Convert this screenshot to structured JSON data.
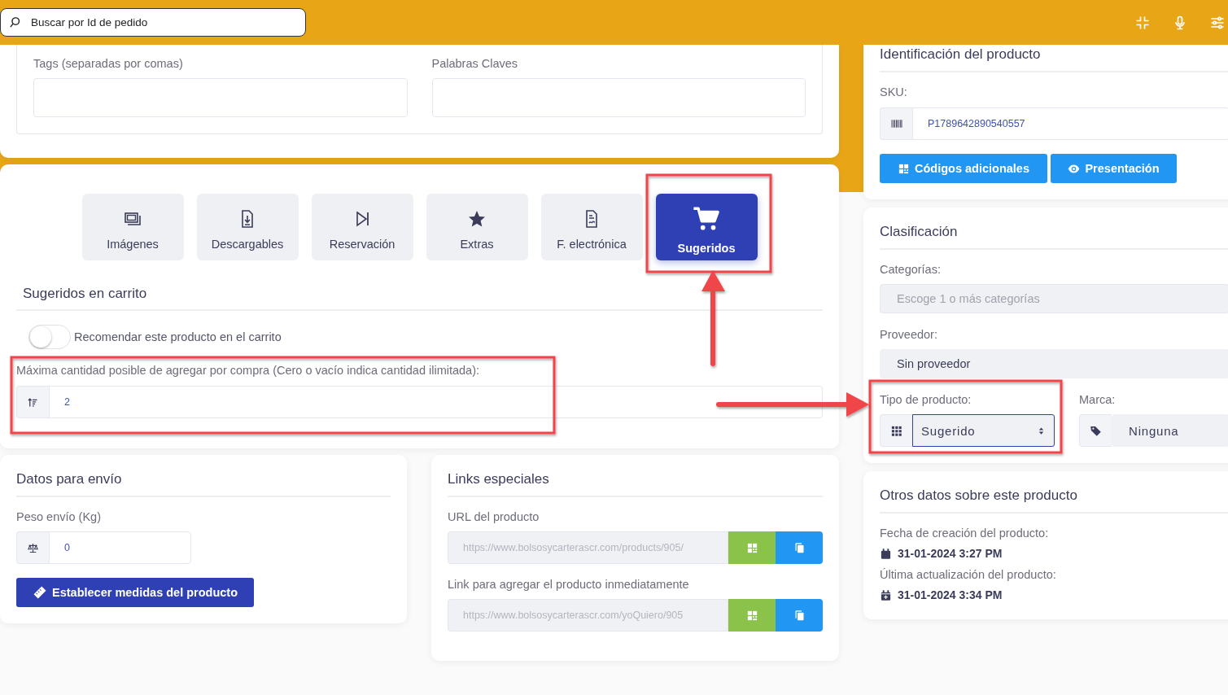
{
  "header": {
    "search": {
      "placeholder": "Buscar por Id de pedido"
    }
  },
  "seo": {
    "fields": [
      {
        "label": "Tags (separadas por comas)"
      },
      {
        "label": "Palabras Claves"
      }
    ]
  },
  "features": {
    "tabs": [
      {
        "label": "Imágenes",
        "kind": "images",
        "selected": false
      },
      {
        "label": "Descargables",
        "kind": "downloads",
        "selected": false
      },
      {
        "label": "Reservación",
        "kind": "reservation",
        "selected": false
      },
      {
        "label": "Extras",
        "kind": "extras",
        "selected": false
      },
      {
        "label": "F. electrónica",
        "kind": "invoice",
        "selected": false
      },
      {
        "label": "Sugeridos",
        "kind": "cart",
        "selected": true
      }
    ]
  },
  "suggested": {
    "title": "Sugeridos en carrito",
    "recommend": {
      "label": "Recomendar este producto en el carrito",
      "on": false
    },
    "max_quantity": {
      "label": "Máxima cantidad posible de agregar por compra (Cero o vacío indica cantidad ilimitada):",
      "value": "2"
    }
  },
  "shipping": {
    "title": "Datos para envío",
    "weight": {
      "label": "Peso envío (Kg)",
      "value": "0"
    },
    "button": "Establecer medidas del producto"
  },
  "links": {
    "title": "Links especiales",
    "items": [
      {
        "label": "URL del producto",
        "value": "https://www.bolsosycarterascr.com/products/905/"
      },
      {
        "label": "Link para agregar el producto inmediatamente",
        "value": "https://www.bolsosycarterascr.com/yoQuiero/905"
      }
    ]
  },
  "identification": {
    "title": "Identificación del producto",
    "sku_label": "SKU:",
    "sku": "P1789642890540557",
    "buttons": [
      {
        "label": "Códigos adicionales",
        "kind": "qr"
      },
      {
        "label": "Presentación",
        "kind": "eye"
      }
    ]
  },
  "classification": {
    "title": "Clasificación",
    "categories": {
      "label": "Categorías:",
      "placeholder": "Escoge 1 o más categorías"
    },
    "provider": {
      "label": "Proveedor:",
      "value": "Sin proveedor"
    },
    "type": {
      "label": "Tipo de producto:",
      "value": "Sugerido"
    },
    "brand": {
      "label": "Marca:",
      "value": "Ninguna"
    }
  },
  "other": {
    "title": "Otros datos sobre este producto",
    "dates": [
      {
        "label": "Fecha de creación del producto:",
        "value": "31-01-2024 3:27 PM",
        "kind": "created"
      },
      {
        "label": "Última actualización del producto:",
        "value": "31-01-2024 3:34 PM",
        "kind": "updated"
      }
    ]
  }
}
